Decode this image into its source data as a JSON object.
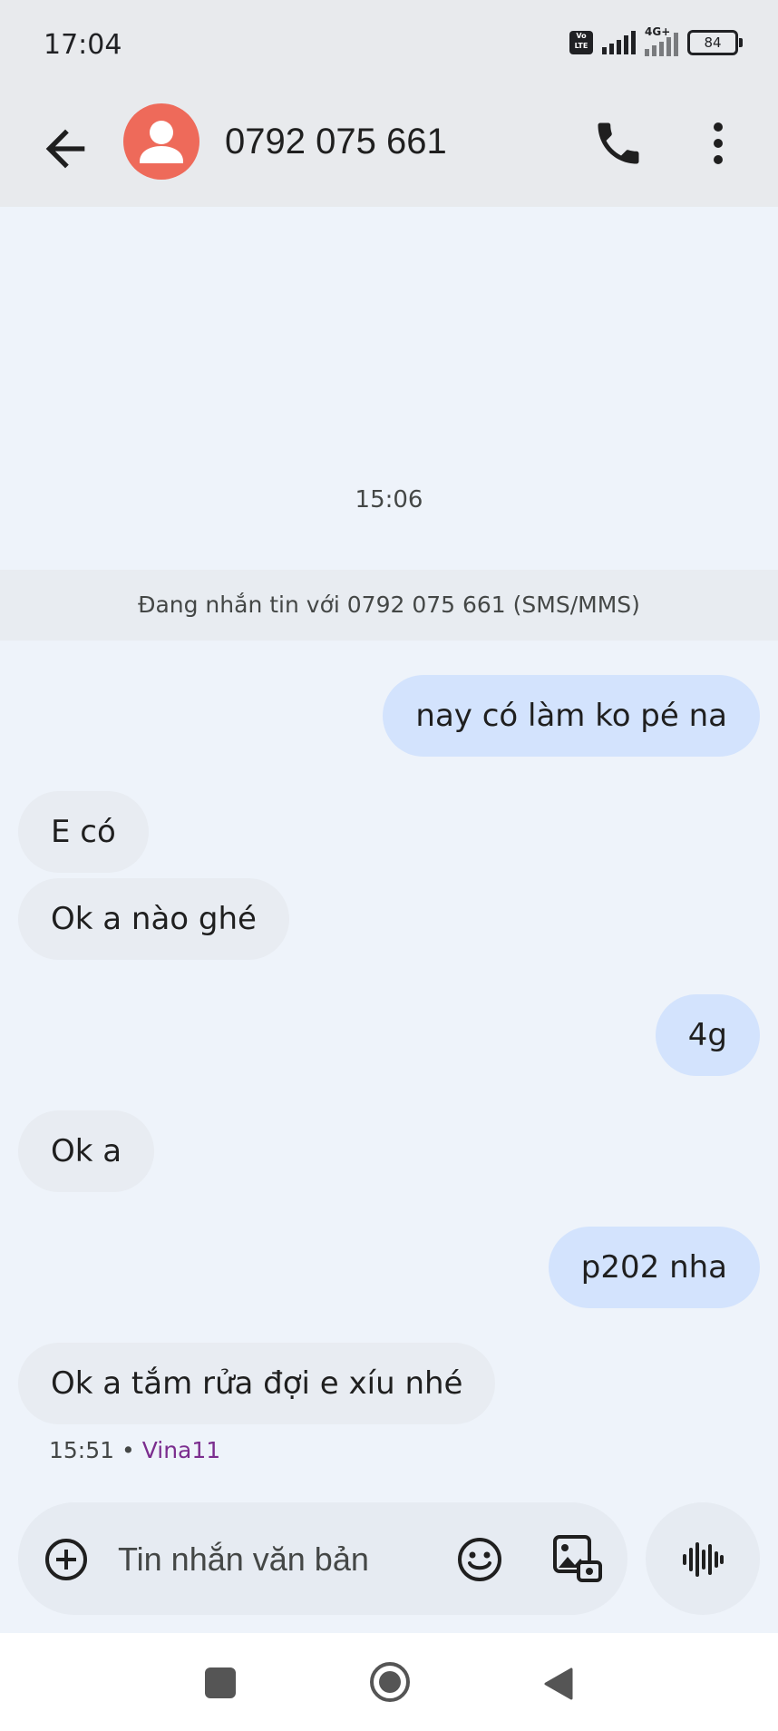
{
  "status_bar": {
    "time": "17:04",
    "volte": "Vo LTE",
    "network": "4G+",
    "battery": "84"
  },
  "header": {
    "title": "0792 075 661"
  },
  "conversation": {
    "timestamp": "15:06",
    "banner": "Đang nhắn tin với 0792 075 661 (SMS/MMS)",
    "messages": [
      {
        "direction": "outgoing",
        "text": "nay có làm ko pé na"
      },
      {
        "direction": "incoming",
        "text": "E có"
      },
      {
        "direction": "incoming",
        "text": "Ok a nào ghé"
      },
      {
        "direction": "outgoing",
        "text": "4g"
      },
      {
        "direction": "incoming",
        "text": "Ok a"
      },
      {
        "direction": "outgoing",
        "text": "p202 nha"
      },
      {
        "direction": "incoming",
        "text": "Ok a tắm rửa đợi e xíu nhé"
      }
    ],
    "last_meta": {
      "time": "15:51",
      "separator": "•",
      "sim": "Vina11"
    }
  },
  "composer": {
    "placeholder": "Tin nhắn văn bản"
  },
  "icons": {
    "back": "arrow-left-icon",
    "avatar": "person-icon",
    "call": "phone-icon",
    "more": "more-vert-icon",
    "add": "add-circle-icon",
    "emoji": "emoji-icon",
    "media": "gallery-icon",
    "voice": "waveform-icon"
  },
  "colors": {
    "outgoing_bubble": "#d3e3fd",
    "incoming_bubble": "#e8ecf2",
    "avatar": "#ee6a5a",
    "sim_label": "#7b2d8e"
  }
}
